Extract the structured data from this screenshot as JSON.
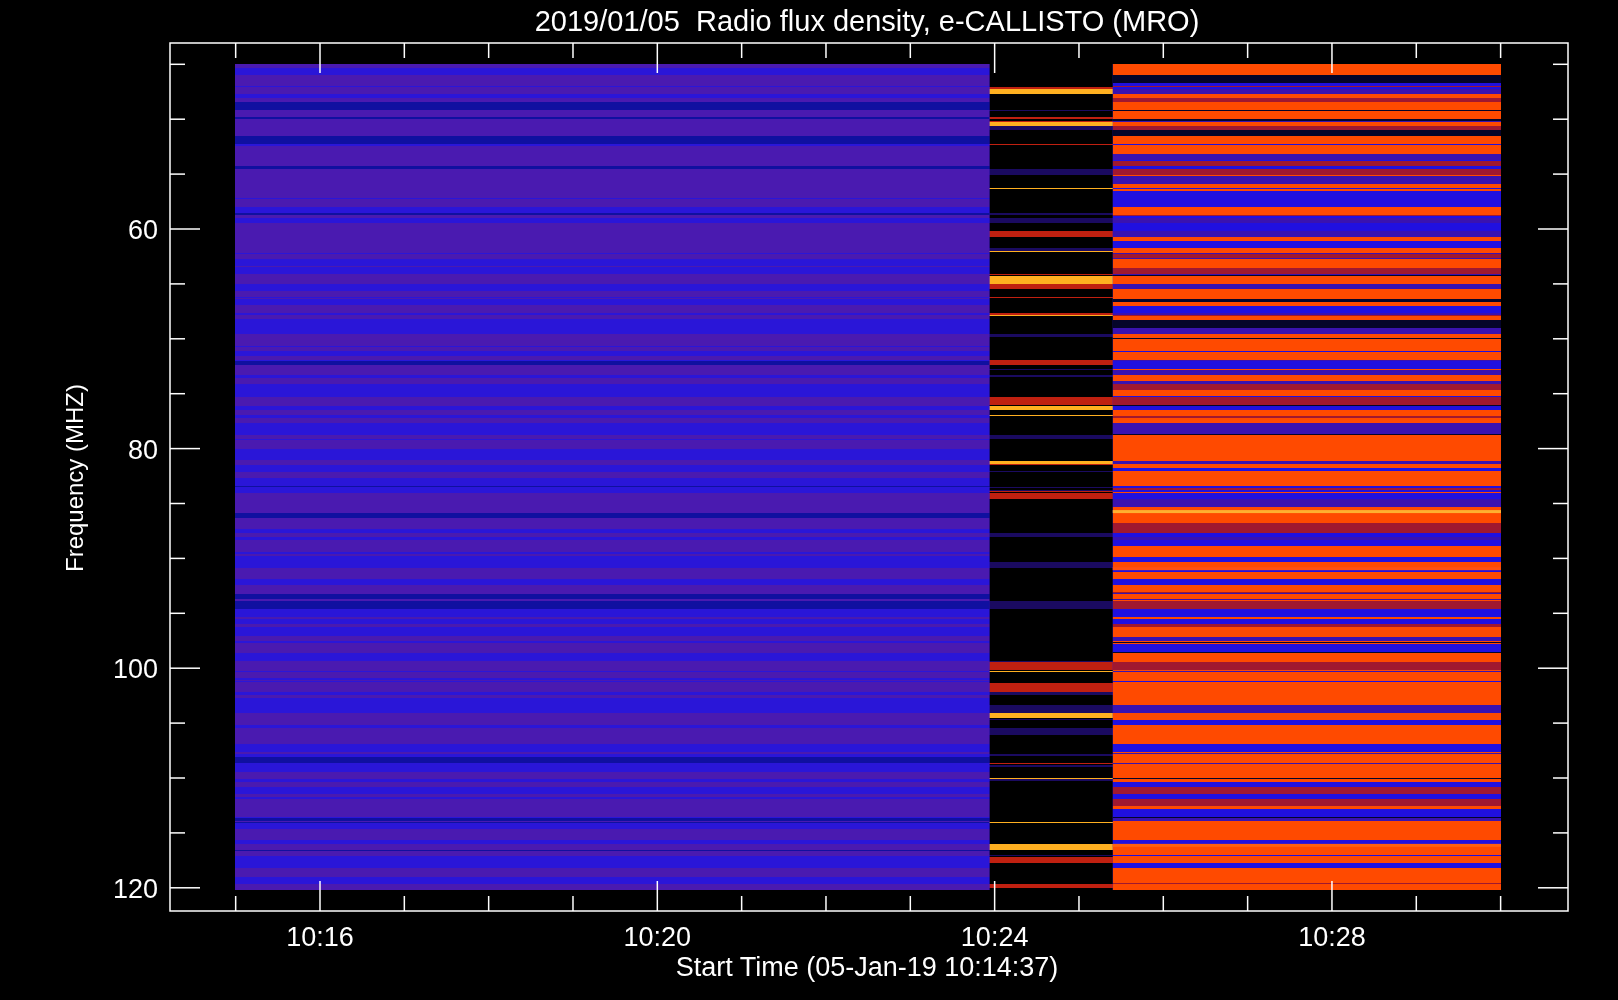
{
  "title": "2019/01/05  Radio flux density, e-CALLISTO (MRO)",
  "y_axis": {
    "label": "Frequency (MHZ)",
    "ticks": [
      "60",
      "80",
      "100",
      "120"
    ]
  },
  "x_axis": {
    "label": "Start Time (05-Jan-19 10:14:37)",
    "ticks": [
      "10:16",
      "10:20",
      "10:24",
      "10:28"
    ]
  }
}
